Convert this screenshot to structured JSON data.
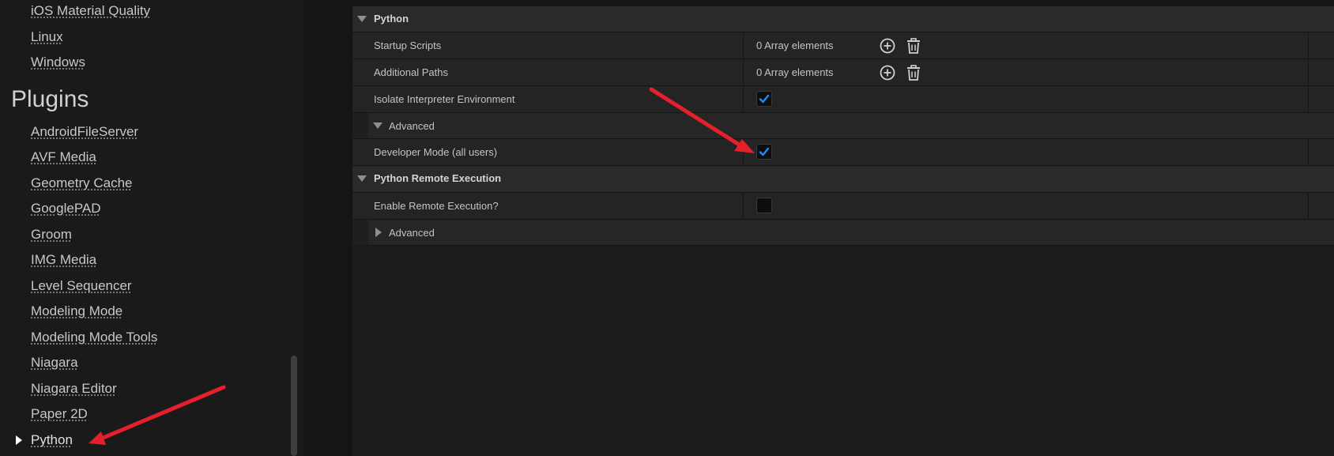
{
  "sidebar": {
    "top_items": [
      "iOS Material Quality",
      "Linux",
      "Windows"
    ],
    "section_heading": "Plugins",
    "plugin_items": [
      "AndroidFileServer",
      "AVF Media",
      "Geometry Cache",
      "GooglePAD",
      "Groom",
      "IMG Media",
      "Level Sequencer",
      "Modeling Mode",
      "Modeling Mode Tools",
      "Niagara",
      "Niagara Editor",
      "Paper 2D",
      "Python"
    ],
    "selected_item": "Python"
  },
  "details": {
    "python": {
      "category": "Python",
      "startup_scripts": {
        "label": "Startup Scripts",
        "value": "0 Array elements"
      },
      "additional_paths": {
        "label": "Additional Paths",
        "value": "0 Array elements"
      },
      "isolate_interpreter": {
        "label": "Isolate Interpreter Environment",
        "checked": true
      },
      "advanced": {
        "label": "Advanced",
        "expanded": true
      },
      "developer_mode": {
        "label": "Developer Mode (all users)",
        "checked": true
      }
    },
    "remote": {
      "category": "Python Remote Execution",
      "enable_remote": {
        "label": "Enable Remote Execution?",
        "checked": false
      },
      "advanced": {
        "label": "Advanced",
        "expanded": false
      }
    }
  },
  "icons": {
    "add": "plus-circle-icon",
    "delete": "trash-icon",
    "check": "checkmark-icon",
    "annotation": "red-arrow-icon"
  },
  "colors": {
    "accent_check": "#1c8cff",
    "annotation_arrow": "#e5202b"
  }
}
